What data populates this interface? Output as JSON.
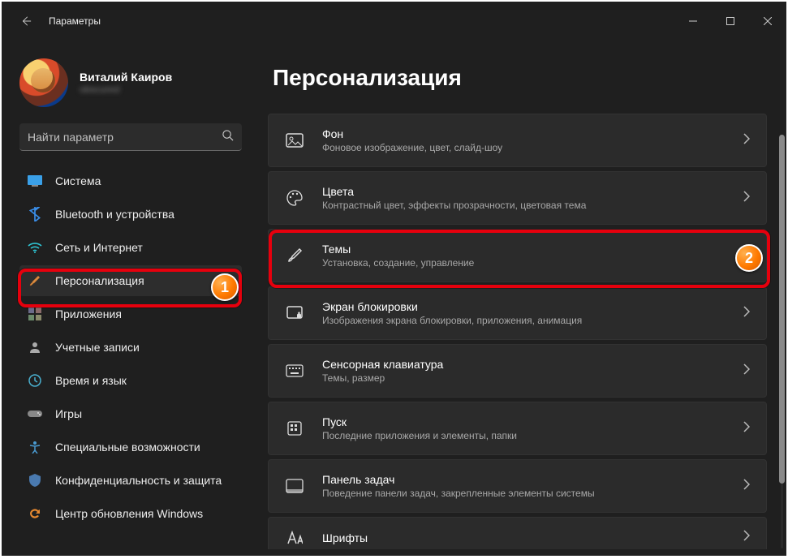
{
  "window": {
    "title": "Параметры"
  },
  "user": {
    "name": "Виталий Каиров",
    "subtitle": "obscured"
  },
  "search": {
    "placeholder": "Найти параметр"
  },
  "nav": [
    {
      "label": "Система",
      "icon": "system",
      "active": false
    },
    {
      "label": "Bluetooth и устройства",
      "icon": "bluetooth",
      "active": false
    },
    {
      "label": "Сеть и Интернет",
      "icon": "wifi",
      "active": false
    },
    {
      "label": "Персонализация",
      "icon": "brush",
      "active": true
    },
    {
      "label": "Приложения",
      "icon": "apps",
      "active": false
    },
    {
      "label": "Учетные записи",
      "icon": "account",
      "active": false
    },
    {
      "label": "Время и язык",
      "icon": "time",
      "active": false
    },
    {
      "label": "Игры",
      "icon": "games",
      "active": false
    },
    {
      "label": "Специальные возможности",
      "icon": "accessibility",
      "active": false
    },
    {
      "label": "Конфиденциальность и защита",
      "icon": "privacy",
      "active": false
    },
    {
      "label": "Центр обновления Windows",
      "icon": "update",
      "active": false
    }
  ],
  "page": {
    "title": "Персонализация"
  },
  "cards": [
    {
      "title": "Фон",
      "subtitle": "Фоновое изображение, цвет, слайд-шоу",
      "icon": "background"
    },
    {
      "title": "Цвета",
      "subtitle": "Контрастный цвет, эффекты прозрачности, цветовая тема",
      "icon": "colors"
    },
    {
      "title": "Темы",
      "subtitle": "Установка, создание, управление",
      "icon": "themes"
    },
    {
      "title": "Экран блокировки",
      "subtitle": "Изображения экрана блокировки, приложения, анимация",
      "icon": "lockscreen"
    },
    {
      "title": "Сенсорная клавиатура",
      "subtitle": "Темы, размер",
      "icon": "touchkeyboard"
    },
    {
      "title": "Пуск",
      "subtitle": "Последние приложения и элементы, папки",
      "icon": "start"
    },
    {
      "title": "Панель задач",
      "subtitle": "Поведение панели задач, закрепленные элементы системы",
      "icon": "taskbar"
    },
    {
      "title": "Шрифты",
      "subtitle": "",
      "icon": "fonts"
    }
  ],
  "annotations": {
    "badge1": "1",
    "badge2": "2"
  }
}
